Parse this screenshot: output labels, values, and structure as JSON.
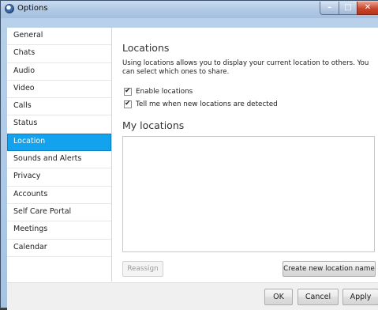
{
  "window": {
    "title": "Options"
  },
  "sidebar": {
    "items": [
      {
        "label": "General"
      },
      {
        "label": "Chats"
      },
      {
        "label": "Audio"
      },
      {
        "label": "Video"
      },
      {
        "label": "Calls"
      },
      {
        "label": "Status"
      },
      {
        "label": "Location",
        "selected": true
      },
      {
        "label": "Sounds and Alerts"
      },
      {
        "label": "Privacy"
      },
      {
        "label": "Accounts"
      },
      {
        "label": "Self Care Portal"
      },
      {
        "label": "Meetings"
      },
      {
        "label": "Calendar"
      }
    ]
  },
  "panel": {
    "heading": "Locations",
    "description": "Using locations allows you to display your current location to others. You can select which ones to share.",
    "options": [
      {
        "label": "Enable locations",
        "checked": true
      },
      {
        "label": "Tell me when new locations are detected",
        "checked": true
      }
    ],
    "my_locations_heading": "My locations",
    "reassign_label": "Reassign",
    "create_label": "Create new location name"
  },
  "footer": {
    "ok_label": "OK",
    "cancel_label": "Cancel",
    "apply_label": "Apply"
  },
  "colors": {
    "accent": "#13a3ee",
    "close_button": "#c8452c"
  }
}
